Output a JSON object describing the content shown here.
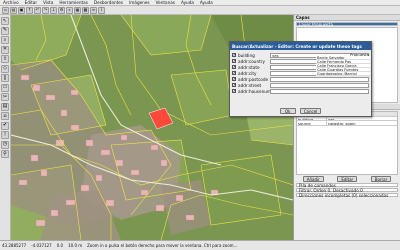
{
  "menu": [
    "Archivo",
    "Editar",
    "Vista",
    "Herramientas",
    "Desbordantes",
    "Imágenes",
    "Ventanas",
    "Ayuda",
    "Ayuda"
  ],
  "dialog": {
    "title": "Buscar/Actualizar - Editor: Create or update these tags",
    "fields": [
      {
        "label": "building",
        "value": "yes"
      },
      {
        "label": "addr:country",
        "value": ""
      },
      {
        "label": "addr:state",
        "value": ""
      },
      {
        "label": "addr:city",
        "value": ""
      },
      {
        "label": "addr:postcode",
        "value": ""
      },
      {
        "label": "addr:street",
        "value": ""
      },
      {
        "label": "addr:housenumber",
        "value": ""
      }
    ],
    "right_header": "Propuesta",
    "right_items": [
      "Barrio Salvador",
      "Calle Fernando Pas",
      "Calle Francisco García",
      "Calle Guardias Fuentes",
      "Guardadopino (Barrio)"
    ],
    "ok_label": "Ok",
    "cancel_label": "Cancel"
  },
  "panels": {
    "layers_title": "Capas",
    "layers": [
      "Layer Propuesta"
    ],
    "props_title": "Etiquetas / Pertenencia",
    "props_header": [
      "Etiqueta",
      "Valor"
    ],
    "props_rows": [
      {
        "key": "building",
        "value": "yes"
      },
      {
        "key": "source",
        "value": "catastro_spain"
      }
    ],
    "props_buttons": [
      "Añadir",
      "Editar",
      "Borrar"
    ],
    "bottom_items": [
      "Pila de comandos",
      "Filtrar. Orden 0. Desactivado 0",
      "Direcciones incompletas (0) seleccionadas"
    ]
  },
  "status": {
    "lat": "43.2885277",
    "lon": "-4.037127",
    "heading": "0.0",
    "length": "10.0 m",
    "hint": "Zoom in o pulsa el botón derecho para mover la ventana. Ctrl para zoom..."
  },
  "colors": {
    "selection": "#ff4a3a",
    "parcel": "#f2e84a",
    "field": "#7d9a52"
  }
}
